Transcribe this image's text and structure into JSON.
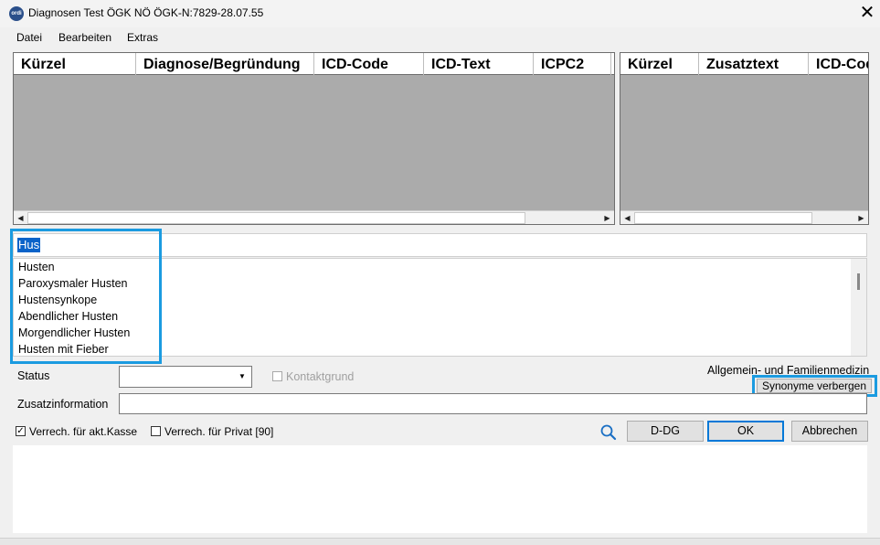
{
  "window": {
    "title": "Diagnosen Test ÖGK NÖ ÖGK-N:7829-28.07.55",
    "app_icon_label": "ordi",
    "close_glyph": "✕"
  },
  "menu": {
    "items": [
      "Datei",
      "Bearbeiten",
      "Extras"
    ]
  },
  "left_grid": {
    "columns": [
      "Kürzel",
      "Diagnose/Begründung",
      "ICD-Code",
      "ICD-Text",
      "ICPC2"
    ]
  },
  "right_grid": {
    "columns": [
      "Kürzel",
      "Zusatztext",
      "ICD-Code"
    ]
  },
  "search": {
    "value": "Hus"
  },
  "suggestions": [
    "Husten",
    "Paroxysmaler Husten",
    "Hustensynkope",
    "Abendlicher Husten",
    "Morgendlicher Husten",
    "Husten mit Fieber"
  ],
  "form": {
    "status_label": "Status",
    "status_value": "",
    "kontaktgrund_label": "Kontaktgrund",
    "kontaktgrund_checked": false,
    "fachgebiet": "Allgemein- und Familienmedizin",
    "synonyme_button": "Synonyme verbergen",
    "zusatz_label": "Zusatzinformation",
    "zusatz_value": "",
    "verrech_kasse_label": "Verrech. für akt.Kasse",
    "verrech_kasse_checked": true,
    "verrech_privat_label": "Verrech. für Privat [90]",
    "verrech_privat_checked": false
  },
  "buttons": {
    "ddg": "D-DG",
    "ok": "OK",
    "abbrechen": "Abbrechen"
  },
  "colors": {
    "highlight": "#1b9be0",
    "grid_bg": "#ababab",
    "selection": "#0a63c9"
  }
}
